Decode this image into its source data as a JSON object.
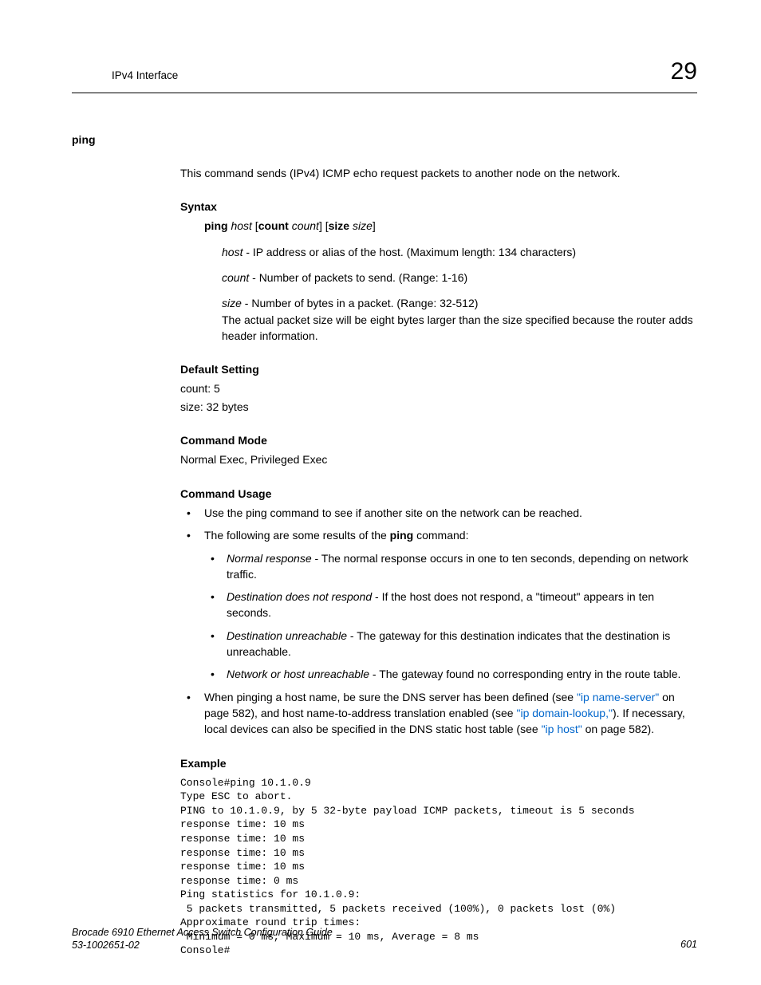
{
  "header": {
    "section": "IPv4 Interface",
    "chapter": "29"
  },
  "command": {
    "name": "ping",
    "intro": "This command sends (IPv4) ICMP echo request packets to another node on the network."
  },
  "syntax": {
    "heading": "Syntax",
    "cmd": "ping",
    "arg_host": "host",
    "lb1": " [",
    "kw_count": "count",
    "sp1": " ",
    "arg_count": "count",
    "rb1": "] [",
    "kw_size": "size",
    "sp2": " ",
    "arg_size": "size",
    "rb2": "]",
    "params": {
      "host_name": "host",
      "host_desc": " - IP address or alias of the host. (Maximum length: 134 characters)",
      "count_name": "count",
      "count_desc": " - Number of packets to send. (Range: 1-16)",
      "size_name": "size",
      "size_desc": " - Number of bytes in a packet. (Range: 32-512)",
      "size_note": "The actual packet size will be eight bytes larger than the size specified because the router adds header information."
    }
  },
  "default": {
    "heading": "Default Setting",
    "l1": "count: 5",
    "l2": "size: 32 bytes"
  },
  "mode": {
    "heading": "Command Mode",
    "text": "Normal Exec, Privileged Exec"
  },
  "usage": {
    "heading": "Command Usage",
    "b1": "Use the ping command to see if another site on the network can be reached.",
    "b2_pre": "The following are some results of the ",
    "b2_bold": "ping",
    "b2_post": " command:",
    "sub": {
      "r1_name": "Normal response",
      "r1_desc": " - The normal response occurs in one to ten seconds, depending on network traffic.",
      "r2_name": "Destination does not respond",
      "r2_desc": " - If the host does not respond, a \"timeout\" appears in ten seconds.",
      "r3_name": "Destination unreachable",
      "r3_desc": " - The gateway for this destination indicates that the destination is unreachable.",
      "r4_name": "Network or host unreachable",
      "r4_desc": " - The gateway found no corresponding entry in the route table."
    },
    "b3_t1": "When pinging a host name, be sure the DNS server has been defined (see ",
    "b3_l1": "\"ip name-server\"",
    "b3_t2": " on page 582), and host name-to-address translation enabled (see ",
    "b3_l2": "\"ip domain-lookup,\"",
    "b3_t3": "). If necessary, local devices can also be specified in the DNS static host table (see ",
    "b3_l3": "\"ip host\"",
    "b3_t4": " on page 582)."
  },
  "example": {
    "heading": "Example",
    "code": "Console#ping 10.1.0.9\nType ESC to abort.\nPING to 10.1.0.9, by 5 32-byte payload ICMP packets, timeout is 5 seconds\nresponse time: 10 ms\nresponse time: 10 ms\nresponse time: 10 ms\nresponse time: 10 ms\nresponse time: 0 ms\nPing statistics for 10.1.0.9:\n 5 packets transmitted, 5 packets received (100%), 0 packets lost (0%)\nApproximate round trip times:\n Minimum = 0 ms, Maximum = 10 ms, Average = 8 ms\nConsole#"
  },
  "footer": {
    "title": "Brocade 6910 Ethernet Access Switch Configuration Guide",
    "docnum": "53-1002651-02",
    "page": "601"
  }
}
